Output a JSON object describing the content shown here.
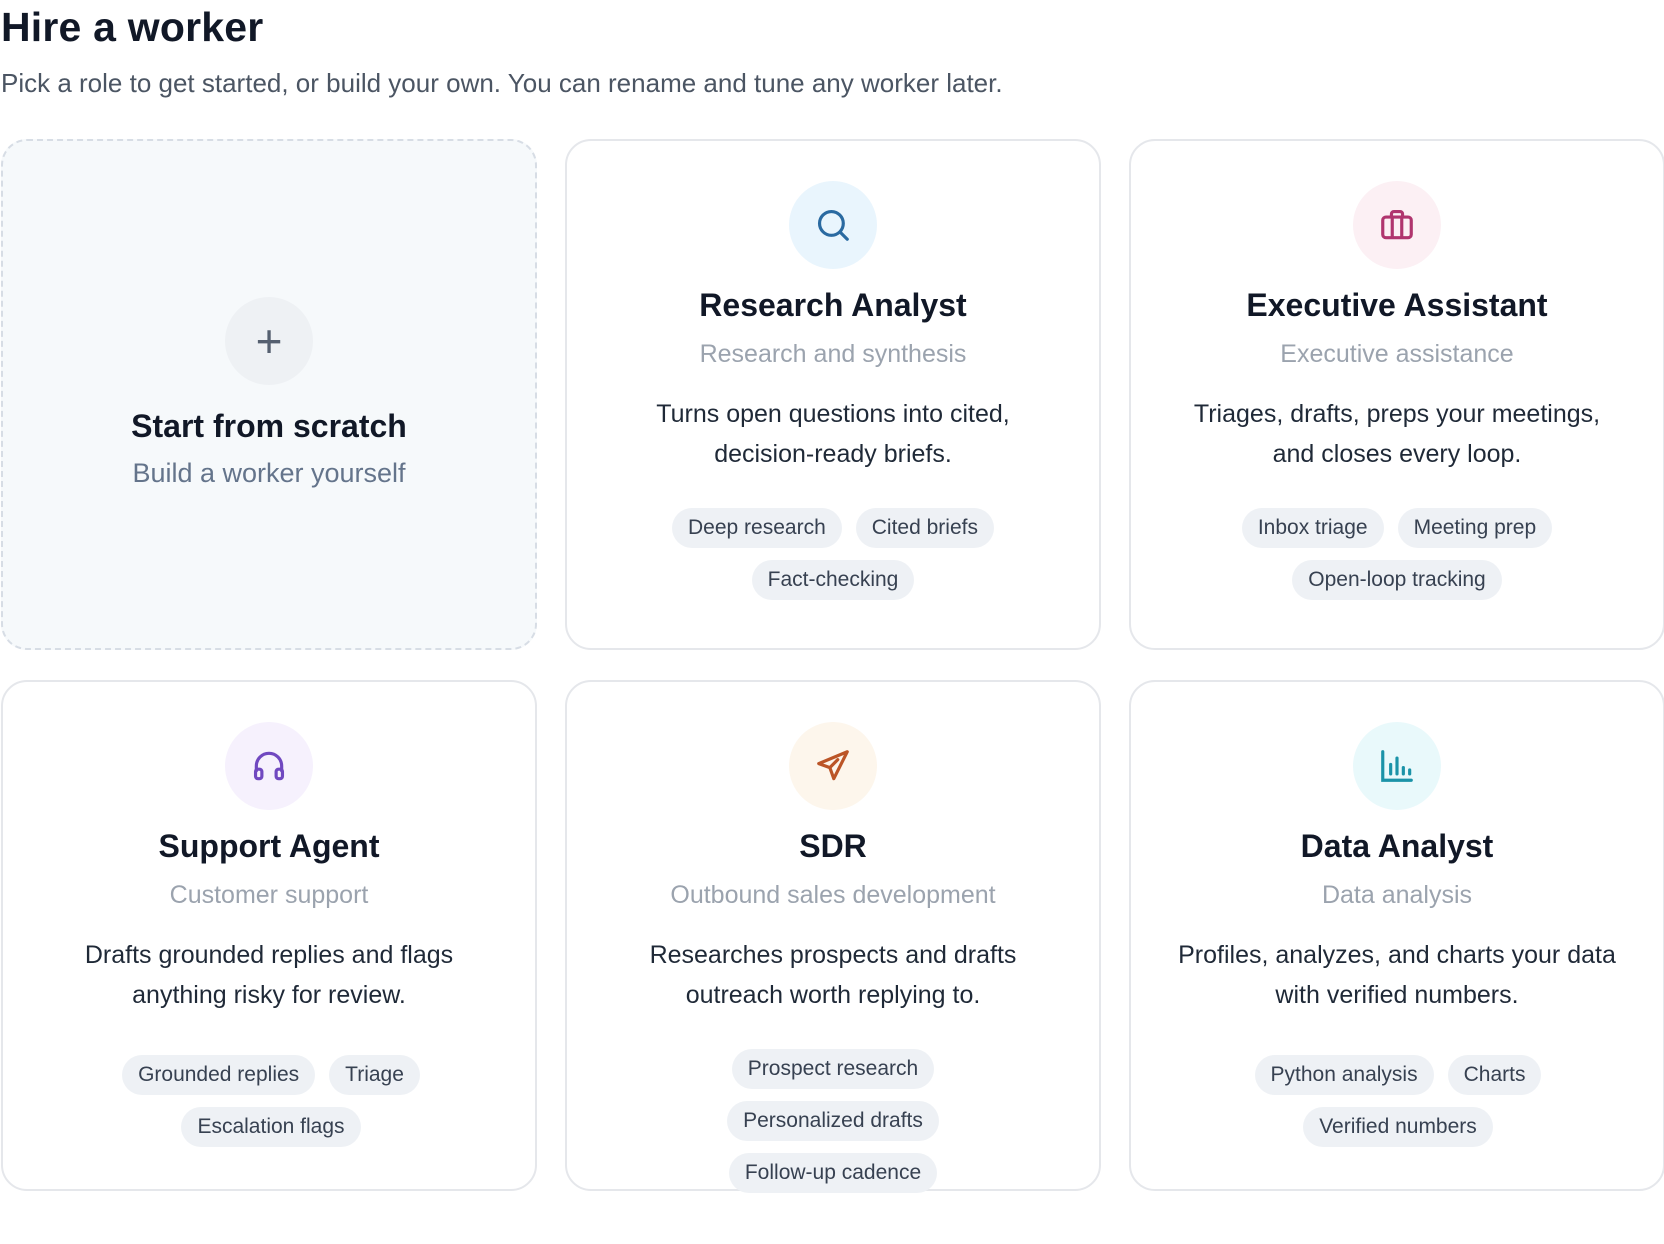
{
  "header": {
    "title": "Hire a worker",
    "subtitle": "Pick a role to get started, or build your own. You can rename and tune any worker later."
  },
  "scratch": {
    "icon": "plus-icon",
    "icon_glyph": "+",
    "name": "Start from scratch",
    "subtitle": "Build a worker yourself"
  },
  "workers": [
    {
      "name": "Research Analyst",
      "category": "Research and synthesis",
      "description": "Turns open questions into cited, decision-ready briefs.",
      "icon": "search-icon",
      "icon_bg": "#e9f5fd",
      "icon_color": "#2a6aa1",
      "tags": [
        "Deep research",
        "Cited briefs",
        "Fact-checking"
      ]
    },
    {
      "name": "Executive Assistant",
      "category": "Executive assistance",
      "description": "Triages, drafts, preps your meetings, and closes every loop.",
      "icon": "briefcase-icon",
      "icon_bg": "#fcf0f4",
      "icon_color": "#b0356e",
      "tags": [
        "Inbox triage",
        "Meeting prep",
        "Open-loop tracking"
      ]
    },
    {
      "name": "Support Agent",
      "category": "Customer support",
      "description": "Drafts grounded replies and flags anything risky for review.",
      "icon": "headphones-icon",
      "icon_bg": "#f6f1fd",
      "icon_color": "#7048c0",
      "tags": [
        "Grounded replies",
        "Triage",
        "Escalation flags"
      ]
    },
    {
      "name": "SDR",
      "category": "Outbound sales development",
      "description": "Researches prospects and drafts outreach worth replying to.",
      "icon": "send-icon",
      "icon_bg": "#fdf6ec",
      "icon_color": "#bb5527",
      "tags": [
        "Prospect research",
        "Personalized drafts",
        "Follow-up cadence"
      ]
    },
    {
      "name": "Data Analyst",
      "category": "Data analysis",
      "description": "Profiles, analyzes, and charts your data with verified numbers.",
      "icon": "bar-chart-icon",
      "icon_bg": "#e9f9fb",
      "icon_color": "#1b93a8",
      "tags": [
        "Python analysis",
        "Charts",
        "Verified numbers"
      ]
    }
  ]
}
